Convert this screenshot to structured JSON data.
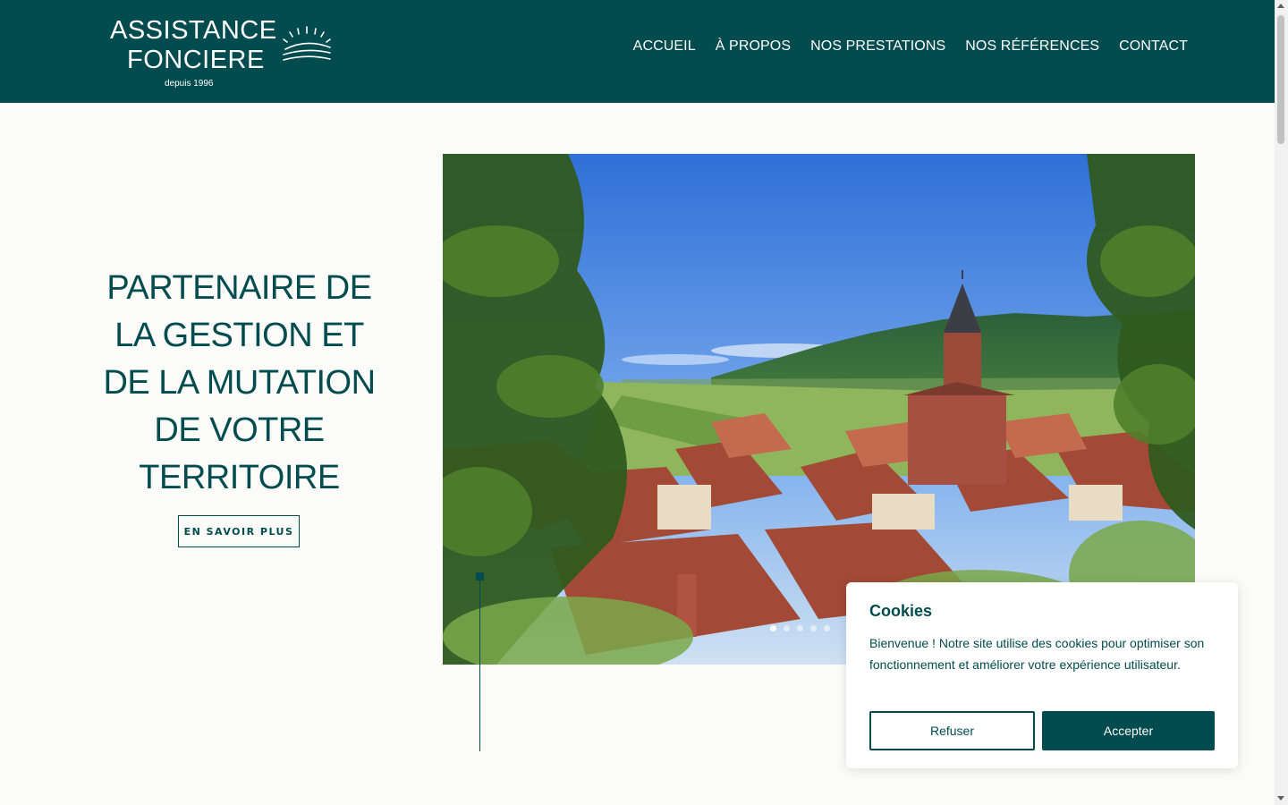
{
  "brand": {
    "line1": "ASSISTANCE",
    "line2": "FONCIERE",
    "sub": "depuis 1996",
    "icon": "sunrise-logo-icon"
  },
  "nav": {
    "items": [
      "ACCUEIL",
      "À PROPOS",
      "NOS PRESTATIONS",
      "NOS RÉFÉRENCES",
      "CONTACT"
    ]
  },
  "hero": {
    "title_lines": [
      "PARTENAIRE DE",
      "LA GESTION ET",
      "DE LA MUTATION",
      "DE VOTRE",
      "TERRITOIRE"
    ],
    "cta_label": "EN SAVOIR PLUS",
    "slider_active": 1,
    "slider_count": 5
  },
  "cookie": {
    "title": "Cookies",
    "text": "Bienvenue ! Notre site utilise des cookies pour optimiser son fonctionnement et améliorer votre expérience utilisateur.",
    "refuse_label": "Refuser",
    "accept_label": "Accepter"
  },
  "colors": {
    "brand": "#024b4e",
    "background": "#fbfbf9",
    "white": "#ffffff"
  }
}
